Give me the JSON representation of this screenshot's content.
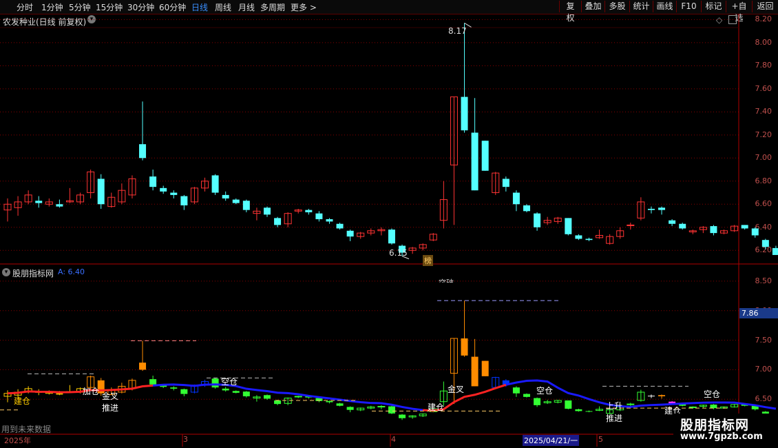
{
  "toolbar": {
    "items": [
      "分时",
      "1分钟",
      "5分钟",
      "15分钟",
      "30分钟",
      "60分钟",
      "日线",
      "周线",
      "月线",
      "多周期",
      "更多 >"
    ],
    "active_index": 6,
    "right_items": [
      "复权",
      "叠加",
      "多股",
      "统计",
      "画线",
      "F10",
      "标记",
      "+自选",
      "返回"
    ]
  },
  "main": {
    "title": "农发种业(日线 前复权)",
    "max_label": "8.17",
    "min_label": "6.15",
    "bang_label": "榜",
    "yaxis": [
      "8.20",
      "8.00",
      "7.80",
      "7.60",
      "7.40",
      "7.20",
      "7.00",
      "6.80",
      "6.60",
      "6.40",
      "6.20"
    ]
  },
  "sub": {
    "title": "股朋指标网",
    "value_label": "A: 6.40",
    "yaxis": [
      "8.50",
      "8.00",
      "7.50",
      "7.00",
      "6.50"
    ],
    "price_tag": "7.86",
    "top_label": "突破",
    "annotations": [
      "建仓",
      "加仓",
      "金叉",
      "推进",
      "空仓",
      "建仓",
      "金叉",
      "空仓",
      "上升",
      "推进",
      "建仓",
      "空仓"
    ]
  },
  "footer": {
    "notice": "用到未来数据",
    "dates": [
      "2025年",
      "3",
      "4",
      "2025/04/21/一",
      "5"
    ]
  },
  "watermark": {
    "brand": "股朋指标网",
    "url": "www.7gpzb.com"
  },
  "colors": {
    "up": "#ff3333",
    "down": "#54ffff",
    "grid": "#8b0000",
    "accent": "#3a8fff"
  },
  "chart_data": [
    {
      "type": "candlestick",
      "title": "农发种业(日线 前复权)",
      "ylim": [
        6.1,
        8.25
      ],
      "y_ticks": [
        8.2,
        8.0,
        7.8,
        7.6,
        7.4,
        7.2,
        7.0,
        6.8,
        6.6,
        6.4,
        6.2
      ],
      "ohlc": [
        [
          6.55,
          6.65,
          6.45,
          6.6
        ],
        [
          6.57,
          6.67,
          6.5,
          6.62
        ],
        [
          6.62,
          6.72,
          6.6,
          6.68
        ],
        [
          6.63,
          6.67,
          6.57,
          6.61
        ],
        [
          6.6,
          6.65,
          6.58,
          6.62
        ],
        [
          6.6,
          6.64,
          6.57,
          6.58
        ],
        [
          6.62,
          6.74,
          6.61,
          6.63
        ],
        [
          6.62,
          6.7,
          6.6,
          6.68
        ],
        [
          6.7,
          6.9,
          6.65,
          6.88
        ],
        [
          6.82,
          6.86,
          6.56,
          6.6
        ],
        [
          6.58,
          6.7,
          6.57,
          6.66
        ],
        [
          6.62,
          6.78,
          6.6,
          6.72
        ],
        [
          6.68,
          6.85,
          6.65,
          6.82
        ],
        [
          7.12,
          7.49,
          6.98,
          7.0
        ],
        [
          6.84,
          6.9,
          6.72,
          6.75
        ],
        [
          6.74,
          6.76,
          6.69,
          6.71
        ],
        [
          6.7,
          6.72,
          6.65,
          6.68
        ],
        [
          6.67,
          6.68,
          6.55,
          6.59
        ],
        [
          6.62,
          6.75,
          6.6,
          6.74
        ],
        [
          6.74,
          6.83,
          6.71,
          6.8
        ],
        [
          6.85,
          6.86,
          6.68,
          6.7
        ],
        [
          6.68,
          6.71,
          6.63,
          6.65
        ],
        [
          6.64,
          6.65,
          6.6,
          6.61
        ],
        [
          6.63,
          6.64,
          6.53,
          6.55
        ],
        [
          6.52,
          6.57,
          6.46,
          6.54
        ],
        [
          6.57,
          6.58,
          6.49,
          6.51
        ],
        [
          6.48,
          6.49,
          6.4,
          6.42
        ],
        [
          6.43,
          6.53,
          6.4,
          6.52
        ],
        [
          6.54,
          6.56,
          6.52,
          6.55
        ],
        [
          6.55,
          6.56,
          6.51,
          6.53
        ],
        [
          6.52,
          6.54,
          6.45,
          6.47
        ],
        [
          6.47,
          6.48,
          6.43,
          6.45
        ],
        [
          6.43,
          6.44,
          6.38,
          6.39
        ],
        [
          6.37,
          6.38,
          6.28,
          6.32
        ],
        [
          6.32,
          6.36,
          6.3,
          6.35
        ],
        [
          6.35,
          6.39,
          6.33,
          6.37
        ],
        [
          6.37,
          6.4,
          6.33,
          6.38
        ],
        [
          6.38,
          6.39,
          6.25,
          6.26
        ],
        [
          6.24,
          6.25,
          6.15,
          6.18
        ],
        [
          6.2,
          6.23,
          6.17,
          6.22
        ],
        [
          6.22,
          6.26,
          6.2,
          6.25
        ],
        [
          6.29,
          6.35,
          6.28,
          6.34
        ],
        [
          6.46,
          6.8,
          6.39,
          6.64
        ],
        [
          6.94,
          7.53,
          6.42,
          7.53
        ],
        [
          7.53,
          8.17,
          7.22,
          7.24
        ],
        [
          7.22,
          7.52,
          6.72,
          6.72
        ],
        [
          7.15,
          7.15,
          6.89,
          6.89
        ],
        [
          6.7,
          6.88,
          6.68,
          6.87
        ],
        [
          6.82,
          6.84,
          6.71,
          6.75
        ],
        [
          6.7,
          6.72,
          6.54,
          6.6
        ],
        [
          6.59,
          6.6,
          6.53,
          6.54
        ],
        [
          6.52,
          6.53,
          6.37,
          6.4
        ],
        [
          6.44,
          6.49,
          6.42,
          6.46
        ],
        [
          6.45,
          6.49,
          6.43,
          6.48
        ],
        [
          6.48,
          6.48,
          6.33,
          6.34
        ],
        [
          6.33,
          6.34,
          6.29,
          6.3
        ],
        [
          6.3,
          6.31,
          6.28,
          6.29
        ],
        [
          6.31,
          6.38,
          6.3,
          6.33
        ],
        [
          6.26,
          6.34,
          6.25,
          6.32
        ],
        [
          6.32,
          6.4,
          6.3,
          6.37
        ],
        [
          6.42,
          6.44,
          6.38,
          6.42
        ],
        [
          6.48,
          6.66,
          6.46,
          6.62
        ],
        [
          6.56,
          6.58,
          6.52,
          6.55
        ],
        [
          6.57,
          6.58,
          6.51,
          6.55
        ],
        [
          6.46,
          6.47,
          6.41,
          6.43
        ],
        [
          6.43,
          6.44,
          6.38,
          6.39
        ],
        [
          6.36,
          6.38,
          6.34,
          6.37
        ],
        [
          6.38,
          6.41,
          6.35,
          6.4
        ],
        [
          6.41,
          6.42,
          6.33,
          6.35
        ],
        [
          6.35,
          6.38,
          6.34,
          6.37
        ],
        [
          6.37,
          6.42,
          6.36,
          6.41
        ],
        [
          6.42,
          6.42,
          6.38,
          6.39
        ],
        [
          6.39,
          6.4,
          6.31,
          6.33
        ],
        [
          6.29,
          6.3,
          6.21,
          6.23
        ],
        [
          6.22,
          6.24,
          6.16,
          6.16
        ]
      ],
      "annotations": {
        "max": 8.17,
        "min": 6.15
      }
    },
    {
      "type": "line",
      "title": "股朋指标网",
      "ylim": [
        6.2,
        8.65
      ],
      "y_ticks": [
        8.5,
        8.0,
        7.5,
        7.0,
        6.5
      ],
      "value": 6.4,
      "price_tag": 7.86
    }
  ]
}
